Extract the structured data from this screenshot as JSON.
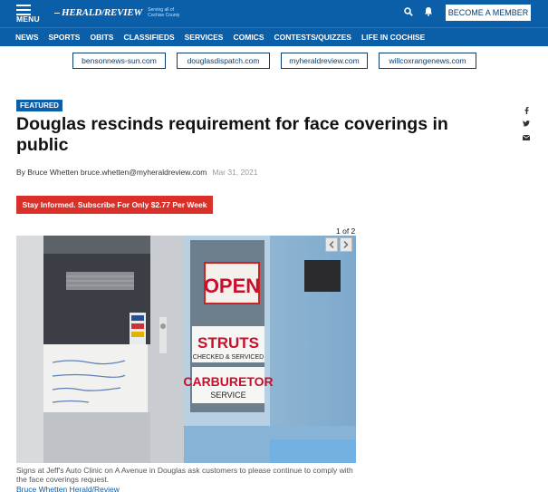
{
  "header": {
    "menu_label": "MENU",
    "logo_text": "HERALD/REVIEW",
    "logo_tagline": "Serving all of Cochise County",
    "member_button": "BECOME A MEMBER",
    "icons": [
      "search-icon",
      "bell-icon"
    ]
  },
  "nav": {
    "items": [
      "NEWS",
      "SPORTS",
      "OBITS",
      "CLASSIFIEDS",
      "SERVICES",
      "COMICS",
      "CONTESTS/QUIZZES",
      "LIFE IN COCHISE"
    ]
  },
  "sister_sites": [
    "bensonnews-sun.com",
    "douglasdispatch.com",
    "myheraldreview.com",
    "willcoxrangenews.com"
  ],
  "article": {
    "badge": "FEATURED",
    "headline": "Douglas rescinds requirement for face coverings in public",
    "byline": "By Bruce Whetten bruce.whetten@myheraldreview.com",
    "date": "Mar 31, 2021",
    "subscribe": "Stay Informed. Subscribe For Only $2.77 Per Week",
    "gallery_counter": "1 of 2",
    "caption": "Signs at Jeff's Auto Clinic on A Avenue in Douglas ask customers to please continue to comply with the face coverings request.",
    "credit": "Bruce Whetten Herald/Review"
  },
  "photo_signs": {
    "open": "OPEN",
    "struts": "STRUTS",
    "struts_sub": "CHECKED & SERVICED",
    "carb": "CARBURETOR",
    "carb_sub": "SERVICE"
  },
  "share_icons": [
    "facebook-icon",
    "twitter-icon",
    "email-icon"
  ],
  "colors": {
    "brand_blue": "#0b5ea8",
    "subscribe_red": "#d9302a"
  }
}
